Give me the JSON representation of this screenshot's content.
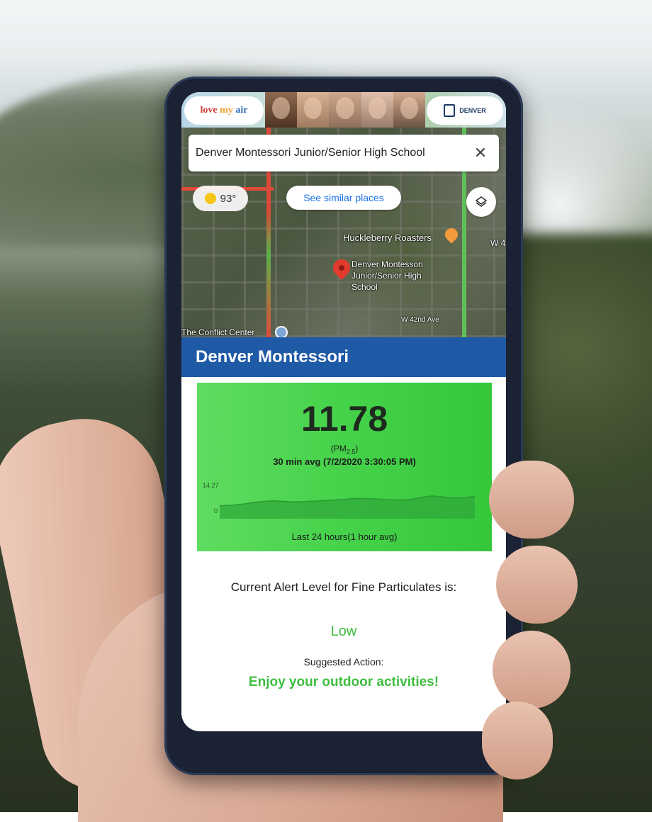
{
  "app": {
    "brand_left": {
      "part1": "love",
      "part2": "my",
      "part3": "air"
    },
    "brand_right": "DENVER"
  },
  "search": {
    "value": "Denver Montessori Junior/Senior High School",
    "clear_icon": "close-icon"
  },
  "map": {
    "temperature": "93°",
    "weather_icon": "sun-icon",
    "similar_places": "See similar places",
    "layers_icon": "layers-icon",
    "labels": {
      "poi": "Huckleberry Roasters",
      "school_line1": "Denver Montessori",
      "school_line2": "Junior/Senior High",
      "school_line3": "School",
      "street": "W 42nd Ave",
      "conflict": "The Conflict Center",
      "edge": "W 4"
    }
  },
  "station": {
    "name": "Denver Montessori",
    "value": "11.78",
    "unit_prefix": "(PM",
    "unit_sub": "2.5",
    "unit_suffix": ")",
    "avg_label": "30 min avg (7/2/2020 3:30:05 PM)",
    "spark_max": "14.27",
    "spark_min": "0",
    "spark_caption": "Last 24 hours(1 hour avg)"
  },
  "chart_data": {
    "type": "area",
    "ylim": [
      0,
      14.27
    ],
    "y": [
      5.2,
      5.4,
      5.8,
      6.4,
      7.0,
      7.2,
      7.0,
      6.8,
      6.9,
      7.1,
      7.3,
      7.6,
      7.9,
      8.2,
      8.1,
      7.9,
      7.6,
      7.5,
      7.8,
      8.6,
      9.2,
      8.8,
      8.2,
      8.5,
      9.0
    ]
  },
  "alert": {
    "text": "Current Alert Level for Fine Particulates is:",
    "level": "Low",
    "suggested_label": "Suggested Action:",
    "action": "Enjoy your outdoor activities!"
  },
  "colors": {
    "header_blue": "#1f5aa6",
    "aqi_green": "#45d24a",
    "level_green": "#3fbe3f"
  }
}
